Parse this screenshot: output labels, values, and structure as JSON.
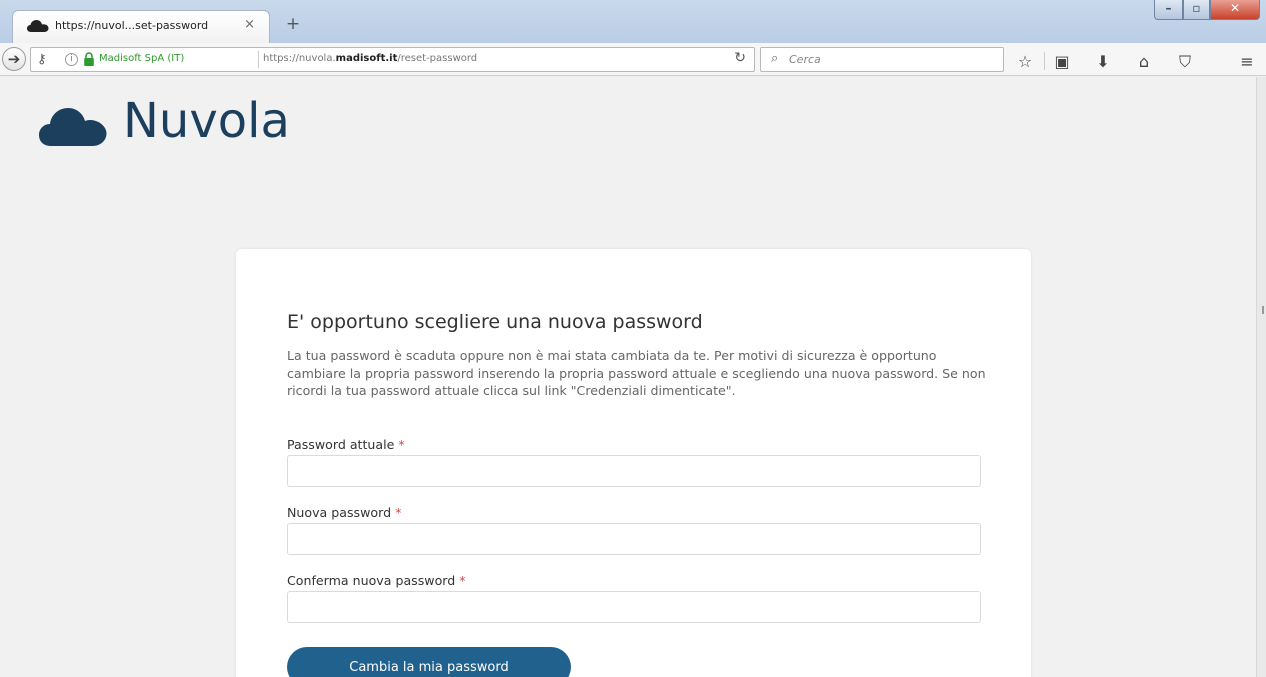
{
  "browser": {
    "tab_title": "https://nuvol...set-password",
    "tab_close": "×",
    "new_tab": "+",
    "site_identity": "Madisoft SpA (IT)",
    "url_prefix": "https://nuvola.",
    "url_domain": "madisoft.it",
    "url_path": "/reset-password",
    "search_placeholder": "Cerca"
  },
  "page": {
    "brand_name": "Nuvola",
    "card": {
      "title": "E' opportuno scegliere una nuova password",
      "description": "La tua password è scaduta oppure non è mai stata cambiata da te. Per motivi di sicurezza è opportuno cambiare la propria password inserendo la propria password attuale e scegliendo una nuova password. Se non ricordi la tua password attuale clicca sul link \"Credenziali dimenticate\".",
      "fields": [
        {
          "label": "Password attuale",
          "required_mark": "*",
          "value": ""
        },
        {
          "label": "Nuova password",
          "required_mark": "*",
          "value": ""
        },
        {
          "label": "Conferma nuova password",
          "required_mark": "*",
          "value": ""
        }
      ],
      "submit_label": "Cambia la mia password"
    }
  },
  "colors": {
    "brand": "#1d3f5e",
    "button": "#21618e",
    "required": "#d34a4a",
    "secure": "#2c9a2c"
  },
  "icons": [
    "cloud-icon",
    "key-icon",
    "info-icon",
    "lock-icon",
    "reload-icon",
    "search-icon",
    "star-icon",
    "clipboard-icon",
    "download-icon",
    "home-icon",
    "pocket-icon",
    "menu-icon"
  ]
}
